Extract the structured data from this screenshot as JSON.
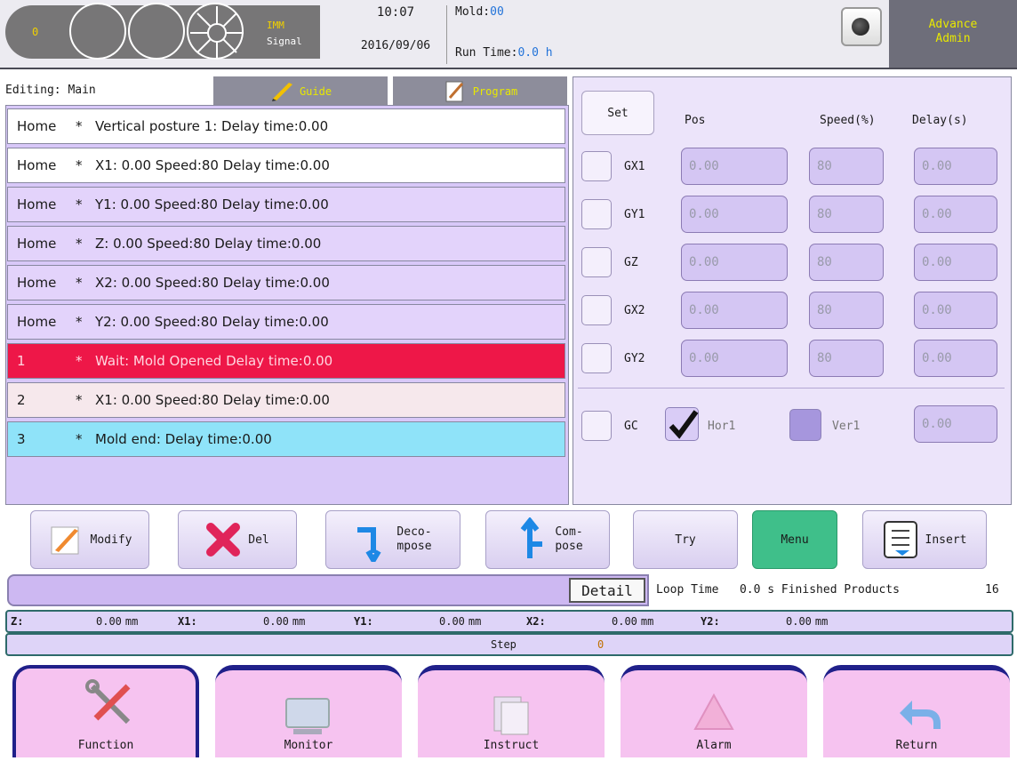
{
  "header": {
    "status_value": "0",
    "imm_label": "IMM",
    "imm_text": "Signal",
    "time": "10:07",
    "date": "2016/09/06",
    "mold_label": "Mold:",
    "mold_value": "00",
    "runtime_label": "Run Time:",
    "runtime_value": "0.0 h",
    "user_role": "Advance",
    "user_name": "Admin"
  },
  "editing": {
    "label": "Editing: Main",
    "tab_guide": "Guide",
    "tab_program": "Program"
  },
  "program_rows": [
    {
      "c1": "Home",
      "c2": "*",
      "text": "Vertical posture 1:  Delay time:0.00",
      "style": "white"
    },
    {
      "c1": "Home",
      "c2": "*",
      "text": "X1: 0.00 Speed:80  Delay time:0.00",
      "style": "white"
    },
    {
      "c1": "Home",
      "c2": "*",
      "text": "Y1: 0.00 Speed:80  Delay time:0.00",
      "style": "lav"
    },
    {
      "c1": "Home",
      "c2": "*",
      "text": "Z: 0.00 Speed:80  Delay time:0.00",
      "style": "lav"
    },
    {
      "c1": "Home",
      "c2": "*",
      "text": "X2: 0.00 Speed:80  Delay time:0.00",
      "style": "lav"
    },
    {
      "c1": "Home",
      "c2": "*",
      "text": "Y2: 0.00 Speed:80  Delay time:0.00",
      "style": "lav"
    },
    {
      "c1": "1",
      "c2": "*",
      "text": "Wait: Mold Opened Delay time:0.00",
      "style": "red"
    },
    {
      "c1": "2",
      "c2": "*",
      "text": "X1: 0.00 Speed:80  Delay time:0.00",
      "style": "pink"
    },
    {
      "c1": "3",
      "c2": "*",
      "text": "Mold end:  Delay time:0.00",
      "style": "cyan"
    }
  ],
  "axis_panel": {
    "set_label": "Set",
    "col_pos": "Pos",
    "col_speed": "Speed(%)",
    "col_delay": "Delay(s)",
    "axes": [
      {
        "name": "GX1",
        "pos": "0.00",
        "speed": "80",
        "delay": "0.00"
      },
      {
        "name": "GY1",
        "pos": "0.00",
        "speed": "80",
        "delay": "0.00"
      },
      {
        "name": "GZ",
        "pos": "0.00",
        "speed": "80",
        "delay": "0.00"
      },
      {
        "name": "GX2",
        "pos": "0.00",
        "speed": "80",
        "delay": "0.00"
      },
      {
        "name": "GY2",
        "pos": "0.00",
        "speed": "80",
        "delay": "0.00"
      }
    ],
    "gc_label": "GC",
    "hor_label": "Hor1",
    "ver_label": "Ver1",
    "gc_delay": "0.00"
  },
  "actions": {
    "modify": "Modify",
    "del": "Del",
    "decompose_1": "Deco-",
    "decompose_2": "mpose",
    "compose_1": "Com-",
    "compose_2": "pose",
    "try": "Try",
    "menu": "Menu",
    "insert": "Insert"
  },
  "detail": {
    "button": "Detail",
    "loop_label": "Loop Time",
    "loop_value": "0.0 s",
    "finished_label": "Finished Products",
    "finished_value": "16"
  },
  "positions": [
    {
      "label": "Z:",
      "value": "0.00",
      "unit": "mm"
    },
    {
      "label": "X1:",
      "value": "0.00",
      "unit": "mm"
    },
    {
      "label": "Y1:",
      "value": "0.00",
      "unit": "mm"
    },
    {
      "label": "X2:",
      "value": "0.00",
      "unit": "mm"
    },
    {
      "label": "Y2:",
      "value": "0.00",
      "unit": "mm"
    }
  ],
  "step": {
    "label": "Step",
    "value": "0"
  },
  "nav": {
    "function": "Function",
    "monitor": "Monitor",
    "instruct": "Instruct",
    "alarm": "Alarm",
    "return": "Return"
  },
  "colors": {
    "highlight_red": "#ee1748",
    "highlight_cyan": "#8fe3f9",
    "menu_green": "#3fbf8a",
    "nav_magenta": "#f6c3f0",
    "nav_frame": "#20208a"
  }
}
